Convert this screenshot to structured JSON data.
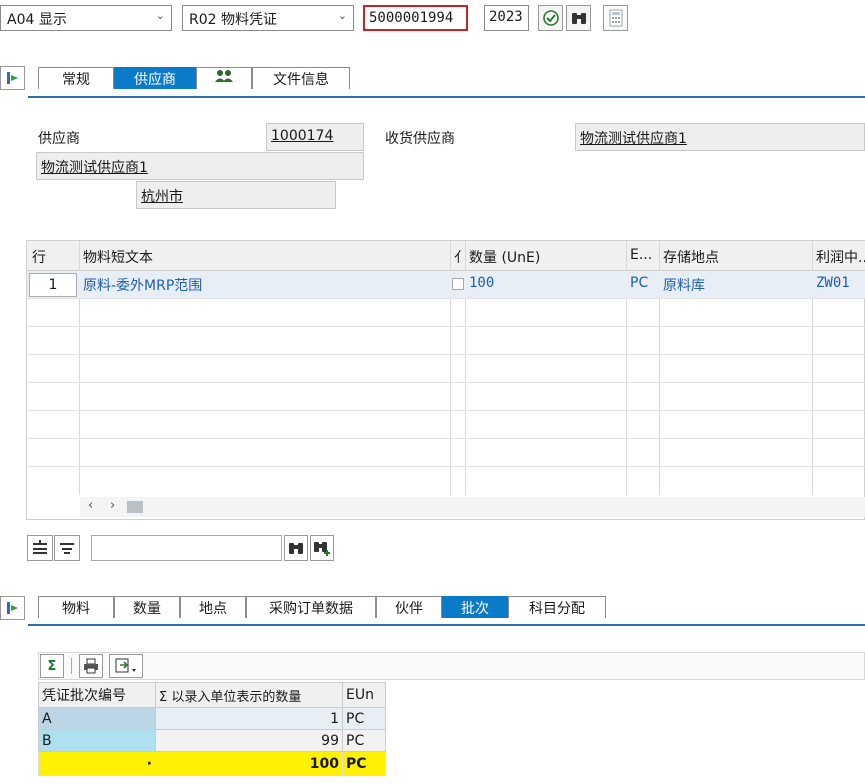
{
  "toolbar": {
    "action": "A04 显示",
    "ref_doc": "R02 物料凭证",
    "doc_number": "5000001994",
    "year": "2023"
  },
  "header_tabs": [
    "常规",
    "供应商",
    "",
    "文件信息"
  ],
  "vendor": {
    "label": "供应商",
    "number": "1000174",
    "name": "物流测试供应商1",
    "city": "杭州市",
    "goods_vendor_label": "收货供应商",
    "goods_vendor_value": "物流测试供应商1"
  },
  "items": {
    "columns": [
      "行",
      "物料短文本",
      "亻",
      "数量 (UnE)",
      "E...",
      "存储地点",
      "利润中..."
    ],
    "rows": [
      {
        "line": "1",
        "text": "原料-委外MRP范围",
        "qty": "100",
        "unit": "PC",
        "sloc": "原料库",
        "profit": "ZW01"
      }
    ]
  },
  "detail_tabs": [
    "物料",
    "数量",
    "地点",
    "采购订单数据",
    "伙伴",
    "批次",
    "科目分配"
  ],
  "batch": {
    "columns": [
      "凭证批次编号",
      "Σ 以录入单位表示的数量",
      "EUn"
    ],
    "rows": [
      {
        "batch": "A",
        "qty": "1",
        "unit": "PC"
      },
      {
        "batch": "B",
        "qty": "99",
        "unit": "PC"
      }
    ],
    "total": {
      "dot": "·",
      "qty": "100",
      "unit": "PC"
    }
  },
  "colors": {
    "accent": "#0a7ac9",
    "total_row": "#fff100",
    "selected_cell": "#bfe0f0"
  }
}
